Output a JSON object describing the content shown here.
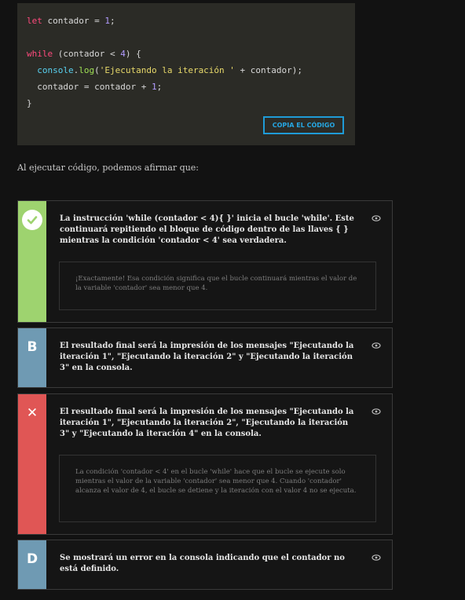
{
  "code": {
    "line1": {
      "kw": "let",
      "pre": " contador = ",
      "num": "1",
      "post": ";"
    },
    "line2": {
      "kw": "while",
      "pre": " (contador < ",
      "num": "4",
      "post": ") {"
    },
    "line3": {
      "obj": "console",
      "dot": ".",
      "fn": "log",
      "open": "(",
      "str": "'Ejecutando la iteración '",
      "post": " + contador);"
    },
    "line4": {
      "pre": "contador = contador + ",
      "num": "1",
      "post": ";"
    },
    "line5": {
      "text": "}"
    },
    "copy_label": "COPIA EL CÓDIGO"
  },
  "question": "Al ejecutar código, podemos afirmar que:",
  "options": [
    {
      "status": "correct",
      "marker": "",
      "color": "#9ed36f",
      "text": "La instrucción 'while (contador < 4){ }' inicia el bucle 'while'. Este continuará repitiendo el bloque de código dentro de las llaves { } mientras la condición 'contador < 4' sea verdadera.",
      "feedback": "¡Exactamente! Esa condición significa que el bucle continuará mientras el valor de la variable 'contador' sea menor que 4."
    },
    {
      "status": "neutral",
      "marker": "B",
      "color": "#6f9ab3",
      "text": "El resultado final será la impresión de los mensajes \"Ejecutando la iteración 1\", \"Ejecutando la iteración 2\" y \"Ejecutando la iteración 3\" en la consola."
    },
    {
      "status": "wrong",
      "marker": "✕",
      "color": "#e05655",
      "text": "El resultado final será la impresión de los mensajes \"Ejecutando la iteración 1\", \"Ejecutando la iteración 2\", \"Ejecutando la iteración 3\" y \"Ejecutando la iteración 4\" en la consola.",
      "feedback": "La condición 'contador < 4' en el bucle 'while' hace que el bucle se ejecute solo mientras el valor de la variable 'contador' sea menor que 4. Cuando 'contador' alcanza el valor de 4, el bucle se detiene y la iteración con el valor 4 no se ejecuta."
    },
    {
      "status": "neutral",
      "marker": "D",
      "color": "#6f9ab3",
      "text": "Se mostrará un error en la consola indicando que el contador no está definido."
    }
  ],
  "icons": {
    "view": "eye-icon",
    "correct": "check-icon",
    "wrong": "close-icon"
  }
}
